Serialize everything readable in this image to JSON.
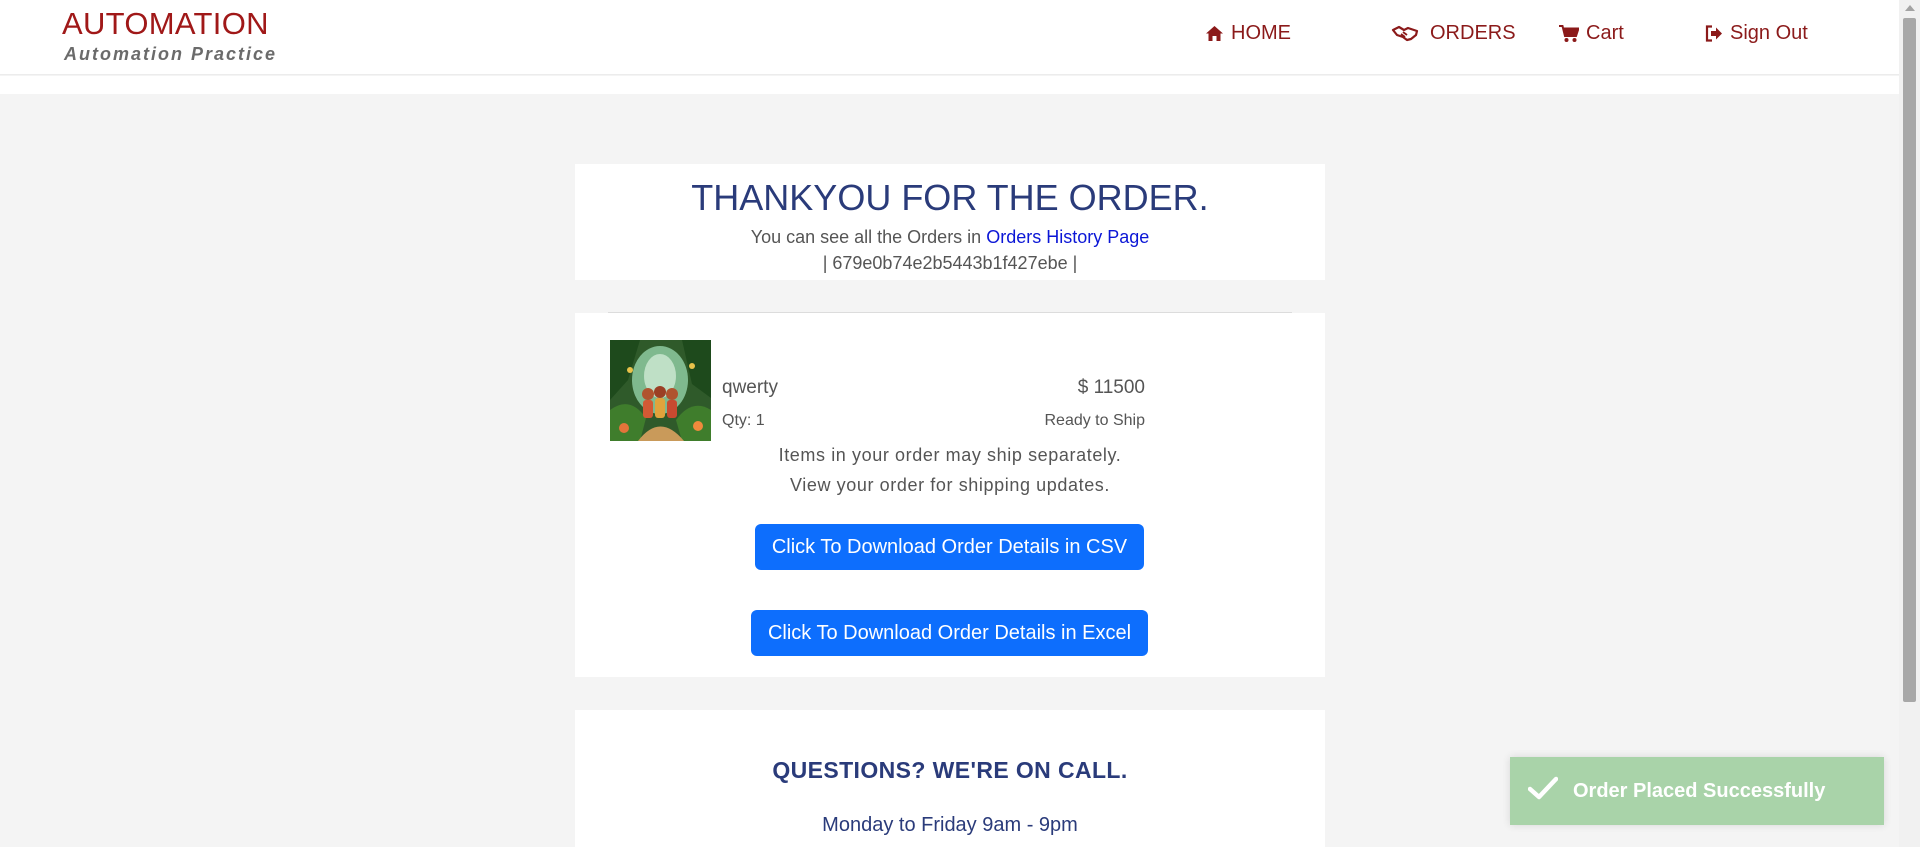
{
  "brand": {
    "title": "AUTOMATION",
    "subtitle": "Automation Practice",
    "color": "#a01818"
  },
  "nav": {
    "home": "HOME",
    "orders": "ORDERS",
    "cart": "Cart",
    "sign_out": "Sign Out",
    "icons": [
      "home-icon",
      "handshake-icon",
      "cart-icon",
      "sign-out-icon"
    ]
  },
  "confirmation": {
    "title": "THANKYOU FOR THE ORDER.",
    "history_prefix": "You can see all the Orders in",
    "history_link": "Orders History Page",
    "order_id": "| 679e0b74e2b5443b1f427ebe |"
  },
  "order_item": {
    "name": "qwerty",
    "price": "$ 11500",
    "qty": "Qty: 1",
    "status": "Ready to Ship"
  },
  "shipping": {
    "line1": "Items in your order may ship separately.",
    "line2": "View your order for shipping updates."
  },
  "buttons": {
    "csv": "Click To Download Order Details in CSV",
    "excel": "Click To Download Order Details in Excel",
    "color": "#0d6efd"
  },
  "questions": {
    "title": "QUESTIONS? WE'RE ON CALL.",
    "hours": "Monday to Friday 9am - 9pm"
  },
  "toast": {
    "message": "Order Placed Successfully",
    "icon": "check-icon",
    "color": "#a9d3a9"
  }
}
